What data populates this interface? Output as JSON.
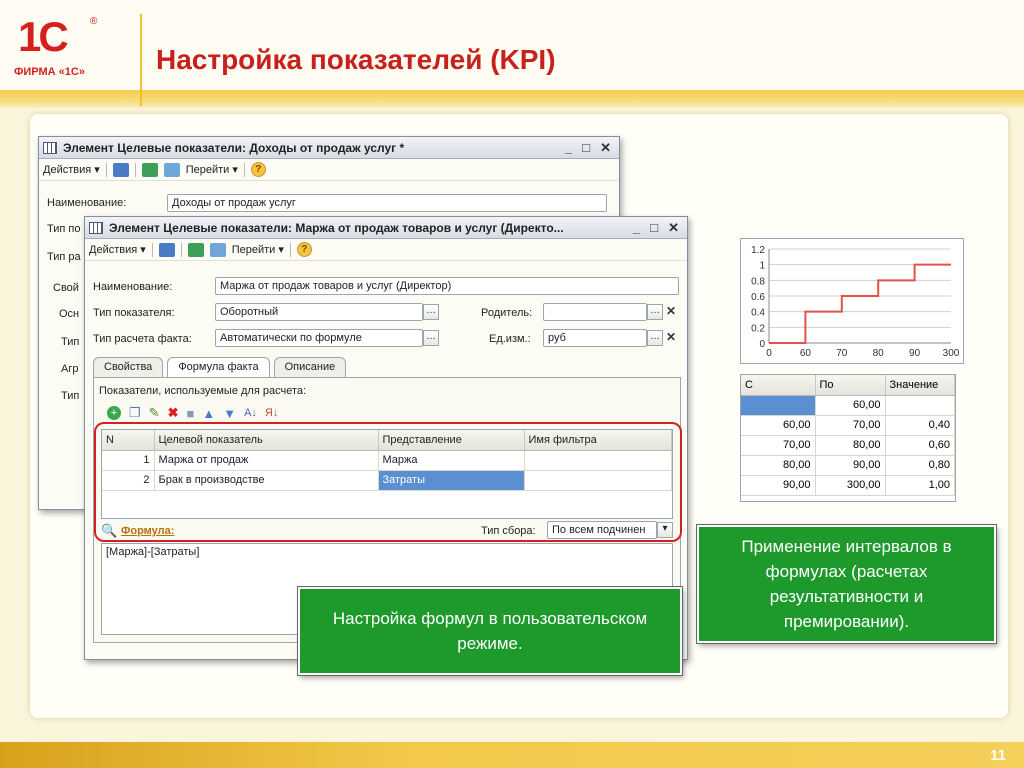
{
  "slide": {
    "logo_mark": "1С",
    "logo_sub": "ФИРМА «1С»",
    "title": "Настройка показателей (KPI)",
    "page_number": "11"
  },
  "back_window": {
    "title": "Элемент Целевые показатели: Доходы от продаж услуг *",
    "actions": "Действия",
    "go_to": "Перейти",
    "name_label": "Наименование:",
    "name_value": "Доходы от продаж услуг",
    "partial_labels": [
      "Тип по",
      "Тип ра",
      "Свой",
      "Осн",
      "Тип",
      "Агр",
      "Тип"
    ]
  },
  "front_window": {
    "title": "Элемент Целевые показатели: Маржа от продаж товаров и услуг (Директо...",
    "actions": "Действия",
    "go_to": "Перейти",
    "name_label": "Наименование:",
    "name_value": "Маржа от продаж товаров и услуг (Директор)",
    "kind_label": "Тип показателя:",
    "kind_value": "Оборотный",
    "parent_label": "Родитель:",
    "parent_value": "",
    "calc_label": "Тип расчета факта:",
    "calc_value": "Автоматически по формуле",
    "unit_label": "Ед.изм.:",
    "unit_value": "руб",
    "tabs": [
      "Свойства",
      "Формула факта",
      "Описание"
    ],
    "indicators_caption": "Показатели, используемые для расчета:",
    "grid_headers": [
      "N",
      "Целевой показатель",
      "Представление",
      "Имя фильтра"
    ],
    "grid_rows": [
      {
        "n": "1",
        "indicator": "Маржа от продаж",
        "view": "Маржа",
        "filter": ""
      },
      {
        "n": "2",
        "indicator": "Брак в производстве",
        "view": "Затраты",
        "filter": ""
      }
    ],
    "formula_link": "Формула:",
    "collect_label": "Тип сбора:",
    "collect_value": "По всем подчинен",
    "formula_text": "[Маржа]-[Затраты]"
  },
  "interval_table": {
    "headers": [
      "С",
      "По",
      "Значение"
    ],
    "rows": [
      [
        "",
        "60,00",
        ""
      ],
      [
        "60,00",
        "70,00",
        "0,40"
      ],
      [
        "70,00",
        "80,00",
        "0,60"
      ],
      [
        "80,00",
        "90,00",
        "0,80"
      ],
      [
        "90,00",
        "300,00",
        "1,00"
      ]
    ]
  },
  "chart_data": {
    "type": "line",
    "categories": [
      "0",
      "60",
      "70",
      "80",
      "90",
      "300"
    ],
    "values": [
      0,
      0.4,
      0.6,
      0.8,
      1.0,
      1.0
    ],
    "y_ticks": [
      "0",
      "0.2",
      "0.4",
      "0.6",
      "0.8",
      "1",
      "1.2"
    ],
    "ylim": [
      0,
      1.2
    ],
    "line_color": "#e0524a"
  },
  "callouts": {
    "formulas": "Настройка формул в пользовательском режиме.",
    "intervals": "Применение интервалов в формулах (расчетах результативности и премировании)."
  }
}
